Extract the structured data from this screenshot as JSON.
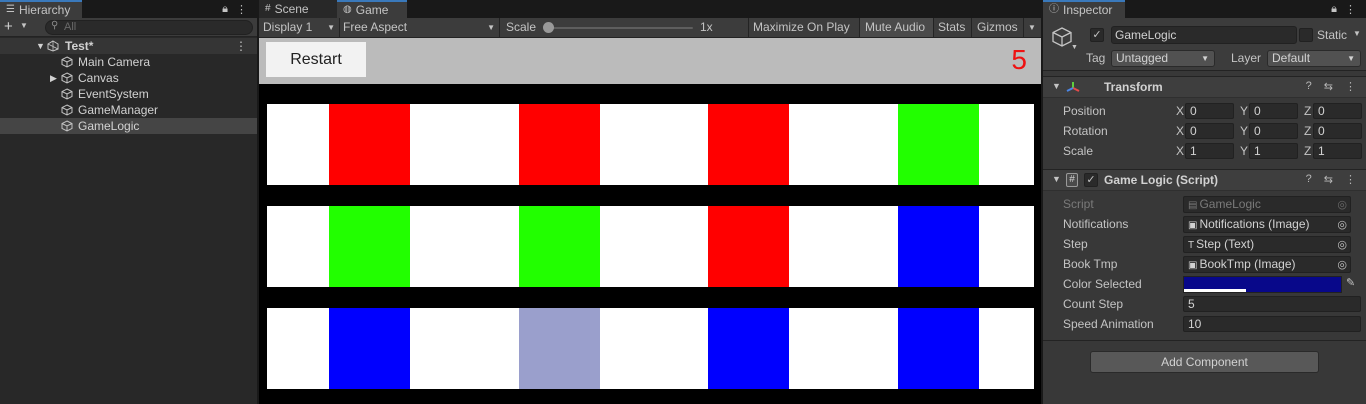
{
  "hierarchy": {
    "tab_label": "Hierarchy",
    "search_placeholder": "All",
    "scene_name": "Test*",
    "items": [
      {
        "label": "Main Camera"
      },
      {
        "label": "Canvas"
      },
      {
        "label": "EventSystem"
      },
      {
        "label": "GameManager"
      },
      {
        "label": "GameLogic"
      }
    ],
    "selected": "GameLogic"
  },
  "game_view": {
    "tabs": [
      {
        "label": "Scene"
      },
      {
        "label": "Game"
      }
    ],
    "active_tab": "Game",
    "display": "Display 1",
    "aspect": "Free Aspect",
    "scale_label": "Scale",
    "scale_value": "1x",
    "maximize_label": "Maximize On Play",
    "mute_label": "Mute Audio",
    "stats_label": "Stats",
    "gizmos_label": "Gizmos",
    "restart_label": "Restart",
    "step_counter": "5",
    "rows": [
      [
        "#ff0000",
        "#ff0000",
        "#ff0000",
        "#22ff00"
      ],
      [
        "#22ff00",
        "#22ff00",
        "#ff0000",
        "#0000ff"
      ],
      [
        "#0000ff",
        "#9a9fcc",
        "#0000ff",
        "#0000ff"
      ]
    ]
  },
  "inspector": {
    "tab_label": "Inspector",
    "object_name": "GameLogic",
    "static_label": "Static",
    "tag_label": "Tag",
    "tag_value": "Untagged",
    "layer_label": "Layer",
    "layer_value": "Default",
    "transform": {
      "title": "Transform",
      "position_label": "Position",
      "rotation_label": "Rotation",
      "scale_label": "Scale",
      "position": {
        "x": "0",
        "y": "0",
        "z": "0"
      },
      "rotation": {
        "x": "0",
        "y": "0",
        "z": "0"
      },
      "scale": {
        "x": "1",
        "y": "1",
        "z": "1"
      }
    },
    "script_component": {
      "title": "Game Logic (Script)",
      "script_label": "Script",
      "script_value": "GameLogic",
      "notifications_label": "Notifications",
      "notifications_value": "Notifications (Image)",
      "step_label": "Step",
      "step_value": "Step (Text)",
      "booktmp_label": "Book Tmp",
      "booktmp_value": "BookTmp (Image)",
      "color_label": "Color Selected",
      "color_value": "#08088a",
      "count_label": "Count Step",
      "count_value": "5",
      "speed_label": "Speed Animation",
      "speed_value": "10"
    },
    "add_component_label": "Add Component"
  }
}
